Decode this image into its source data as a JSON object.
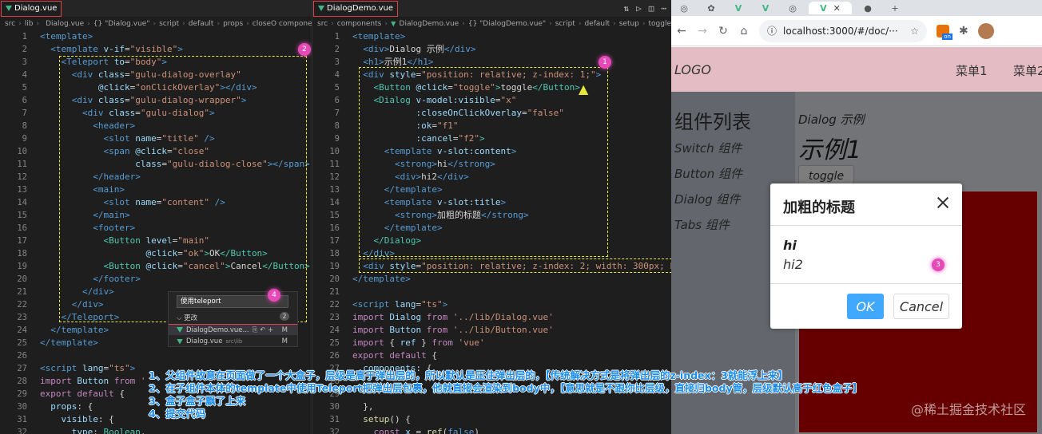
{
  "left_editor": {
    "tab": "Dialog.vue",
    "breadcrumbs": [
      "src",
      "lib",
      "Dialog.vue",
      "{} \"Dialog.vue\"",
      "script",
      "default",
      "props",
      "closeO components"
    ],
    "lines": [
      {
        "n": "1",
        "html": "<span class='t-tag'>&lt;template&gt;</span>"
      },
      {
        "n": "2",
        "html": "  <span class='t-tag'>&lt;template</span> <span class='t-attr'>v-if</span>=<span class='t-str'>\"visible\"</span><span class='t-tag'>&gt;</span>"
      },
      {
        "n": "3",
        "html": "    <span class='t-tag'>&lt;Teleport</span> <span class='t-attr'>to</span>=<span class='t-str'>\"body\"</span><span class='t-tag'>&gt;</span>"
      },
      {
        "n": "4",
        "html": "      <span class='t-tag'>&lt;div</span> <span class='t-attr'>class</span>=<span class='t-str'>\"gulu-dialog-overlay\"</span>"
      },
      {
        "n": "5",
        "html": "           <span class='t-attr'>@click</span>=<span class='t-str'>\"onClickOverlay\"</span><span class='t-tag'>&gt;&lt;/div&gt;</span>"
      },
      {
        "n": "6",
        "html": "      <span class='t-tag'>&lt;div</span> <span class='t-attr'>class</span>=<span class='t-str'>\"gulu-dialog-wrapper\"</span><span class='t-tag'>&gt;</span>"
      },
      {
        "n": "7",
        "html": "        <span class='t-tag'>&lt;div</span> <span class='t-attr'>class</span>=<span class='t-str'>\"gulu-dialog\"</span><span class='t-tag'>&gt;</span>"
      },
      {
        "n": "8",
        "html": "          <span class='t-tag'>&lt;header&gt;</span>"
      },
      {
        "n": "9",
        "html": "            <span class='t-tag'>&lt;slot</span> <span class='t-attr'>name</span>=<span class='t-str'>\"title\"</span> <span class='t-tag'>/&gt;</span>"
      },
      {
        "n": "10",
        "html": "            <span class='t-tag'>&lt;span</span> <span class='t-attr'>@click</span>=<span class='t-str'>\"close\"</span>"
      },
      {
        "n": "11",
        "html": "                  <span class='t-attr'>class</span>=<span class='t-str'>\"gulu-dialog-close\"</span><span class='t-tag'>&gt;&lt;/span&gt;</span>"
      },
      {
        "n": "12",
        "html": "          <span class='t-tag'>&lt;/header&gt;</span>"
      },
      {
        "n": "13",
        "html": "          <span class='t-tag'>&lt;main&gt;</span>"
      },
      {
        "n": "14",
        "html": "            <span class='t-tag'>&lt;slot</span> <span class='t-attr'>name</span>=<span class='t-str'>\"content\"</span> <span class='t-tag'>/&gt;</span>"
      },
      {
        "n": "15",
        "html": "          <span class='t-tag'>&lt;/main&gt;</span>"
      },
      {
        "n": "16",
        "html": "          <span class='t-tag'>&lt;footer&gt;</span>"
      },
      {
        "n": "17",
        "html": "            <span class='t-cls'>&lt;Button</span> <span class='t-attr'>level</span>=<span class='t-str'>\"main\"</span>"
      },
      {
        "n": "18",
        "html": "                    <span class='t-attr'>@click</span>=<span class='t-str'>\"ok\"</span><span class='t-cls'>&gt;</span>OK<span class='t-cls'>&lt;/Button&gt;</span>"
      },
      {
        "n": "19",
        "html": "            <span class='t-cls'>&lt;Button</span> <span class='t-attr'>@click</span>=<span class='t-str'>\"cancel\"</span><span class='t-cls'>&gt;</span>Cancel<span class='t-cls'>&lt;/Button&gt;</span>"
      },
      {
        "n": "20",
        "html": "          <span class='t-tag'>&lt;/footer&gt;</span>"
      },
      {
        "n": "21",
        "html": "        <span class='t-tag'>&lt;/div&gt;</span>"
      },
      {
        "n": "22",
        "html": "      <span class='t-tag'>&lt;/div&gt;</span>"
      },
      {
        "n": "23",
        "html": "    <span class='t-tag'>&lt;/Teleport&gt;</span>"
      },
      {
        "n": "24",
        "html": "  <span class='t-tag'>&lt;/template&gt;</span>"
      },
      {
        "n": "25",
        "html": "<span class='t-tag'>&lt;/template&gt;</span>"
      },
      {
        "n": "26",
        "html": ""
      },
      {
        "n": "27",
        "html": "<span class='t-tag'>&lt;script</span> <span class='t-attr'>lang</span>=<span class='t-str'>\"ts\"</span><span class='t-tag'>&gt;</span>"
      },
      {
        "n": "28",
        "html": "<span class='t-kw'>import</span> <span class='t-var'>Button</span> <span class='t-kw'>from</span> <span class='t-str'>'</span>"
      },
      {
        "n": "29",
        "html": "<span class='t-kw'>export default</span> {"
      },
      {
        "n": "30",
        "html": "  <span class='t-var'>props</span>: {"
      },
      {
        "n": "31",
        "html": "    <span class='t-var'>visible</span>: {"
      },
      {
        "n": "32",
        "html": "      <span class='t-var'>type</span>: <span class='t-cls'>Boolean</span>,"
      }
    ]
  },
  "mid_editor": {
    "tab": "DialogDemo.vue",
    "breadcrumbs": [
      "src",
      "components",
      "DialogDemo.vue",
      "{} \"DialogDemo.vue\"",
      "script",
      "default",
      "setup",
      "toggle"
    ],
    "lines": [
      {
        "n": "1",
        "html": "<span class='t-tag'>&lt;template&gt;</span>"
      },
      {
        "n": "2",
        "html": "  <span class='t-tag'>&lt;div&gt;</span>Dialog 示例<span class='t-tag'>&lt;/div&gt;</span>"
      },
      {
        "n": "3",
        "html": "  <span class='t-tag'>&lt;h1&gt;</span>示例1<span class='t-tag'>&lt;/h1&gt;</span>"
      },
      {
        "n": "4",
        "html": "  <span class='t-tag'>&lt;div</span> <span class='t-attr'>style</span>=<span class='t-str'>\"position: relative; z-index: 1;\"</span><span class='t-tag'>&gt;</span>"
      },
      {
        "n": "5",
        "html": "    <span class='t-cls'>&lt;Button</span> <span class='t-attr'>@click</span>=<span class='t-str'>\"toggle\"</span><span class='t-cls'>&gt;</span>toggle<span class='t-cls'>&lt;/Button&gt;</span>"
      },
      {
        "n": "6",
        "html": "    <span class='t-cls'>&lt;Dialog</span> <span class='t-attr'>v-model:visible</span>=<span class='t-str'>\"x\"</span>"
      },
      {
        "n": "7",
        "html": "            <span class='t-attr'>:closeOnClickOverlay</span>=<span class='t-str'>\"false\"</span>"
      },
      {
        "n": "8",
        "html": "            <span class='t-attr'>:ok</span>=<span class='t-str'>\"f1\"</span>"
      },
      {
        "n": "9",
        "html": "            <span class='t-attr'>:cancel</span>=<span class='t-str'>\"f2\"</span><span class='t-cls'>&gt;</span>"
      },
      {
        "n": "10",
        "html": "      <span class='t-tag'>&lt;template</span> <span class='t-attr'>v-slot:content</span><span class='t-tag'>&gt;</span>"
      },
      {
        "n": "11",
        "html": "        <span class='t-tag'>&lt;strong&gt;</span>hi<span class='t-tag'>&lt;/strong&gt;</span>"
      },
      {
        "n": "12",
        "html": "        <span class='t-tag'>&lt;div&gt;</span>hi2<span class='t-tag'>&lt;/div&gt;</span>"
      },
      {
        "n": "13",
        "html": "      <span class='t-tag'>&lt;/template&gt;</span>"
      },
      {
        "n": "14",
        "html": "      <span class='t-tag'>&lt;template</span> <span class='t-attr'>v-slot:title</span><span class='t-tag'>&gt;</span>"
      },
      {
        "n": "15",
        "html": "        <span class='t-tag'>&lt;strong&gt;</span>加粗的标题<span class='t-tag'>&lt;/strong&gt;</span>"
      },
      {
        "n": "16",
        "html": "      <span class='t-tag'>&lt;/template&gt;</span>"
      },
      {
        "n": "17",
        "html": "    <span class='t-cls'>&lt;/Dialog&gt;</span>"
      },
      {
        "n": "18",
        "html": "  <span class='t-tag'>&lt;/div&gt;</span>"
      },
      {
        "n": "19",
        "html": "  <span class='t-tag'>&lt;div</span> <span class='t-attr'>style</span>=<span class='t-str'>\"position: relative; z-index: 2; width: 300px; he</span>"
      },
      {
        "n": "20",
        "html": "<span class='t-tag'>&lt;/template&gt;</span>"
      },
      {
        "n": "21",
        "html": ""
      },
      {
        "n": "22",
        "html": "<span class='t-tag'>&lt;script</span> <span class='t-attr'>lang</span>=<span class='t-str'>\"ts\"</span><span class='t-tag'>&gt;</span>"
      },
      {
        "n": "23",
        "html": "<span class='t-kw'>import</span> <span class='t-var'>Dialog</span> <span class='t-kw'>from</span> <span class='t-str'>'../lib/Dialog.vue'</span>"
      },
      {
        "n": "24",
        "html": "<span class='t-kw'>import</span> <span class='t-var'>Button</span> <span class='t-kw'>from</span> <span class='t-str'>'../lib/Button.vue'</span>"
      },
      {
        "n": "25",
        "html": "<span class='t-kw'>import</span> { <span class='t-var'>ref</span> } <span class='t-kw'>from</span> <span class='t-str'>'vue'</span>"
      },
      {
        "n": "26",
        "html": "<span class='t-kw'>export default</span> {"
      },
      {
        "n": "27",
        "html": "  <span class='t-var'>components</span>: {"
      },
      {
        "n": "28",
        "html": ""
      },
      {
        "n": "29",
        "html": ""
      },
      {
        "n": "30",
        "html": "  },"
      },
      {
        "n": "31",
        "html": "  <span class='t-fn'>setup</span>() {"
      },
      {
        "n": "32",
        "html": "    <span class='t-kw'>const</span> <span class='t-var'>x</span> = <span class='t-fn'>ref</span>(<span class='t-bool'>false</span>)"
      }
    ]
  },
  "commit_popup": {
    "message": "使用teleport",
    "group_label": "更改",
    "count": "2",
    "files": [
      {
        "name": "DialogDemo.vue...",
        "path": "",
        "state": "M"
      },
      {
        "name": "Dialog.vue",
        "path": "src\\lib",
        "state": "M"
      }
    ]
  },
  "markers": {
    "m1": "1",
    "m2": "2",
    "m3": "3",
    "m4": "4"
  },
  "notes": [
    "1、父组件故意在页面做了一个大盒子，层级是高于弹出层的，所以默认是压住弹出层的，【传统解决方式是将弹出层的z-index：3就能浮上来】",
    "2、在子组件本体的template中使用Teleport把弹出层包裹，他就直接会渲染到body中，【意思就是不跟你比层级，直接归body管，层级默认高于红色盒子】",
    "3、盒子盒子飘了上来",
    "4、提交代码"
  ],
  "browser": {
    "url": "localhost:3000/#/doc/···",
    "ext_badge": "on",
    "header": {
      "logo": "LOGO",
      "menu1": "菜单1",
      "menu2": "菜单2"
    },
    "aside": {
      "title": "组件列表",
      "items": [
        "Switch 组件",
        "Button 组件",
        "Dialog 组件",
        "Tabs 组件"
      ]
    },
    "content": {
      "label": "Dialog 示例",
      "title": "示例1",
      "toggle": "toggle"
    },
    "dialog": {
      "title": "加粗的标题",
      "hi": "hi",
      "hi2": "hi2",
      "ok": "OK",
      "cancel": "Cancel"
    },
    "watermark": "@稀土掘金技术社区"
  }
}
